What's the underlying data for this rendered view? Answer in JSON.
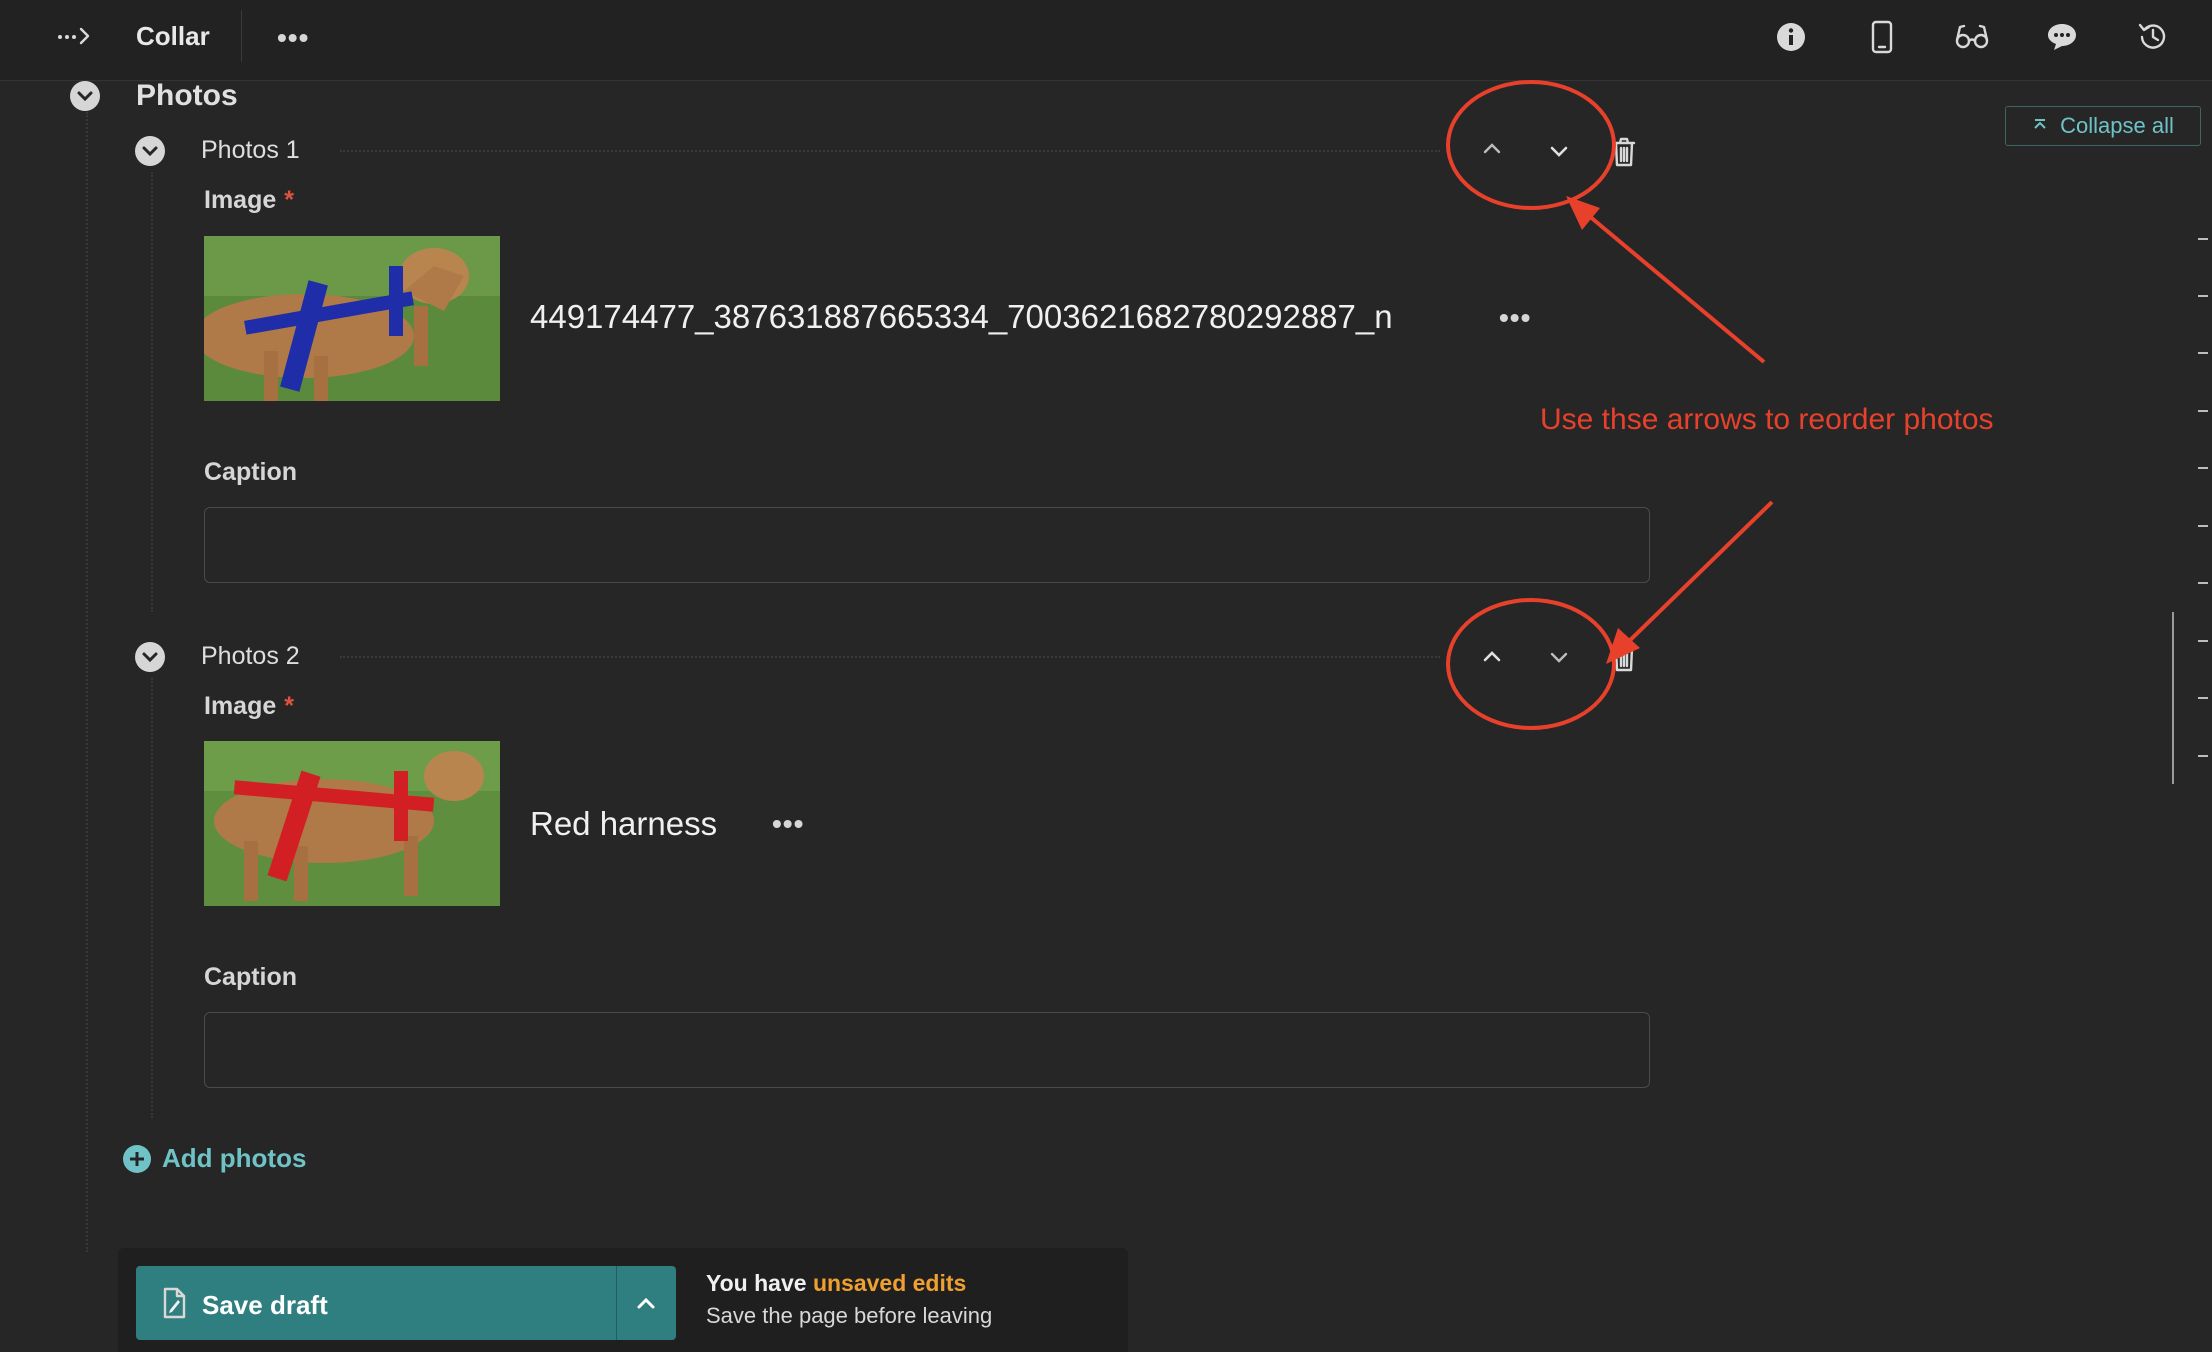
{
  "topbar": {
    "title": "Collar",
    "more_label": "•••",
    "icons": [
      "breadcrumb-arrow-icon",
      "info-icon",
      "mobile-icon",
      "glasses-icon",
      "comment-icon",
      "history-icon"
    ]
  },
  "section": {
    "title": "Photos",
    "collapse_all": "Collapse all"
  },
  "items": [
    {
      "title": "Photos 1",
      "image_label": "Image",
      "required_mark": "*",
      "filename": "449174477_387631887665334_7003621682780292887_n",
      "more_label": "•••",
      "caption_label": "Caption",
      "caption_value": "",
      "harness_color": "#1f2ea8"
    },
    {
      "title": "Photos 2",
      "image_label": "Image",
      "required_mark": "*",
      "filename": "Red harness",
      "more_label": "•••",
      "caption_label": "Caption",
      "caption_value": "",
      "harness_color": "#d11f23"
    }
  ],
  "add_photos": "Add photos",
  "annotation": {
    "text": "Use thse arrows to reorder photos",
    "color": "#e8412b"
  },
  "savebar": {
    "save_label": "Save draft",
    "status_prefix": "You have ",
    "status_highlight": "unsaved edits",
    "status_sub": "Save the page before leaving",
    "highlight_color": "#f0a030",
    "button_color": "#2f7f80"
  }
}
